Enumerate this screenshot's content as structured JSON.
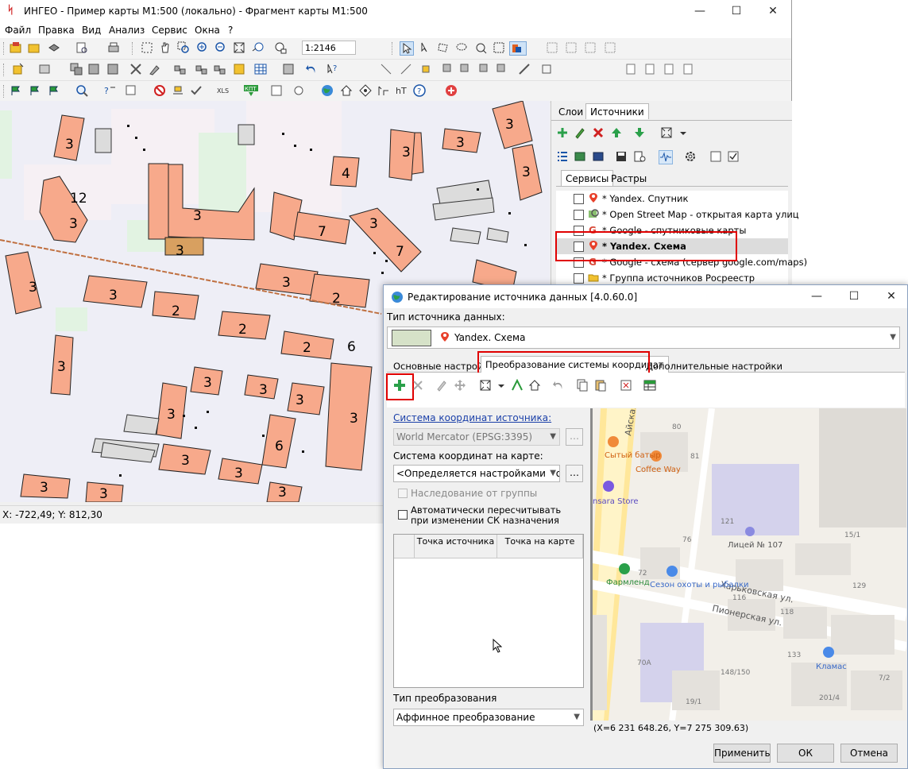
{
  "main_window": {
    "title": "ИНГЕО - Пример карты М1:500 (локально) - Фрагмент карты М1:500",
    "controls": {
      "minimize": "—",
      "maximize": "☐",
      "close": "✕"
    },
    "menu": [
      "Файл",
      "Правка",
      "Вид",
      "Анализ",
      "Сервис",
      "Окна",
      "?"
    ],
    "scale_value": "1:2146",
    "status_text": "X: -722,49; Y: 812,30"
  },
  "right_panel": {
    "top_tabs": [
      "Слои",
      "Источники"
    ],
    "sub_tabs": [
      "Сервисы",
      "Растры"
    ],
    "sources": [
      {
        "label": "* Yandex. Спутник",
        "icon": "map-pin-icon",
        "bold": false
      },
      {
        "label": "* Open Street Map - открытая карта улиц",
        "icon": "magnifier-map-icon",
        "bold": false
      },
      {
        "label": "* Google - спутниковые карты",
        "icon": "google-icon",
        "bold": false
      },
      {
        "label": "* Yandex. Схема",
        "icon": "map-pin-icon",
        "bold": true
      },
      {
        "label": "* Google - схема (сервер google.com/maps)",
        "icon": "google-icon",
        "bold": false
      },
      {
        "label": "* Группа источников Росреестр",
        "icon": "folder-icon",
        "bold": false
      }
    ]
  },
  "map_labels": [
    "3",
    "3",
    "12",
    "3",
    "3",
    "7",
    "4",
    "3",
    "3",
    "3",
    "3",
    "7",
    "3",
    "3",
    "2",
    "3",
    "2",
    "2",
    "2",
    "6",
    "3",
    "3",
    "3",
    "3",
    "3",
    "6",
    "3",
    "3",
    "3",
    "3",
    "3",
    "3",
    "3"
  ],
  "dialog": {
    "title": "Редактирование источника данных [4.0.60.0]",
    "source_type_label": "Тип источника данных:",
    "source_type_value": "Yandex. Схема",
    "tabs": [
      "Основные настройки",
      "Преобразование системы координат",
      "Дополнительные настройки"
    ],
    "source_cs_link": "Система координат источника:",
    "source_cs_value": "World Mercator (EPSG:3395)",
    "map_cs_label": "Система координат на карте:",
    "map_cs_value": "<Определяется настройками модуля>",
    "inherit_label": "Наследование от группы",
    "auto_recalc_label": "Автоматически пересчитывать при изменении СК назначения",
    "grid_headers": [
      "Точка источника",
      "Точка на карте"
    ],
    "transform_type_label": "Тип преобразования",
    "transform_type_value": "Аффинное преобразование",
    "preview_coords": "(X=6 231 648.26, Y=7 275 309.63)",
    "preview_labels": {
      "street1": "Айская",
      "street2": "Харьковская ул.",
      "street3": "Пионерская ул.",
      "poi1": "Сытый батыр",
      "poi2": "Coffee Way",
      "poi3": "nsara Store",
      "poi4": "Лицей № 107",
      "poi5": "Фармленд",
      "poi6": "Сезон охоты и рыбалки",
      "poi7": "Кламас",
      "n80": "80",
      "n81": "81",
      "n121": "121",
      "n151": "15/1",
      "n76": "76",
      "n72": "72",
      "n116": "116",
      "n118": "118",
      "n129": "129",
      "n133": "133",
      "n70a": "70А",
      "n148": "148/150",
      "n72b": "7/2",
      "n191": "19/1",
      "n2014": "201/4"
    },
    "buttons": {
      "apply": "Применить",
      "ok": "ОК",
      "cancel": "Отмена"
    }
  },
  "colors": {
    "highlight_red": "#e00000",
    "building_fill": "#f7a98b",
    "link_blue": "#1a3fa8"
  }
}
